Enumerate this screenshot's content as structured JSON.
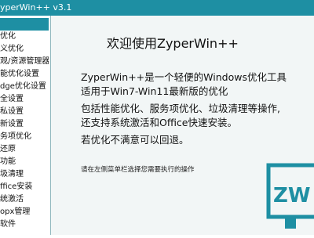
{
  "window": {
    "title": "yperWin++ v3.1"
  },
  "sidebar": {
    "items": [
      {
        "label": "",
        "selected": true
      },
      {
        "label": "优化"
      },
      {
        "label": "义优化"
      },
      {
        "label": "观/资源管理器"
      },
      {
        "label": "能优化设置"
      },
      {
        "label": "dge优化设置"
      },
      {
        "label": "全设置"
      },
      {
        "label": "私设置"
      },
      {
        "label": "新设置"
      },
      {
        "label": "务项优化"
      },
      {
        "label": "还原"
      },
      {
        "label": "功能"
      },
      {
        "label": "圾清理"
      },
      {
        "label": "ffice安装"
      },
      {
        "label": "统激活"
      },
      {
        "label": "opx管理"
      },
      {
        "label": "软件"
      }
    ]
  },
  "main": {
    "heading": "欢迎使用ZyperWin++",
    "lines": [
      "ZyperWin++是一个轻便的Windows优化工具",
      "适用于Win7-Win11最新版的优化",
      "包括性能优化、服务项优化、垃圾清理等操作,",
      "还支持系统激活和Office快速安装。",
      "若优化不满意可以回退。"
    ],
    "note": "请在左侧菜单栏选择您需要执行的操作"
  },
  "logo": {
    "text": "ZW",
    "color": "#1e8fa3"
  }
}
